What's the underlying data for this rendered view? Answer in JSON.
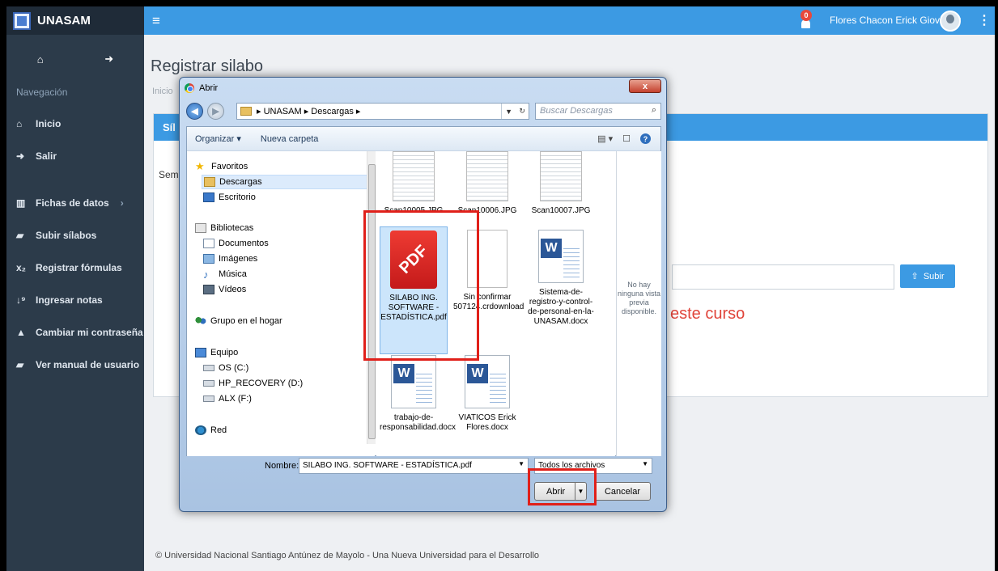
{
  "app": {
    "brand": "UNASAM",
    "user_name": "Flores Chacon Erick Giovanny",
    "notification_count": "0",
    "sidebar": {
      "nav_header": "Navegación",
      "items": [
        {
          "label": "Inicio",
          "icon": "home-icon"
        },
        {
          "label": "Salir",
          "icon": "sign-out-icon"
        },
        {
          "label": "Fichas de datos",
          "icon": "bar-chart-icon",
          "chevron": "›"
        },
        {
          "label": "Subir sílabos",
          "icon": "book-icon"
        },
        {
          "label": "Registrar fórmulas",
          "icon": "subscript-icon"
        },
        {
          "label": "Ingresar notas",
          "icon": "sort-numeric-icon"
        },
        {
          "label": "Cambiar mi contraseña",
          "icon": "lock-icon"
        },
        {
          "label": "Ver manual de usuario",
          "icon": "book-icon"
        }
      ]
    },
    "page_title": "Registrar silabo",
    "breadcrumb": "Inicio",
    "panel_heading": "Síl",
    "semester_label": "Sem",
    "upload_button": "Subir",
    "no_syllabus_text": "este curso",
    "footer": "© Universidad Nacional Santiago Antúnez de Mayolo - Una Nueva Universidad para el Desarrollo",
    "colors": {
      "topbar": "#3c9ae3",
      "sidebar": "#2c3b4a",
      "alert": "#e0443a"
    }
  },
  "dialog": {
    "title": "Abrir",
    "close": "x",
    "address": [
      "UNASAM",
      "Descargas"
    ],
    "search_placeholder": "Buscar Descargas",
    "toolbar": {
      "organize": "Organizar ▾",
      "new_folder": "Nueva carpeta"
    },
    "nav_pane": {
      "favorites": "Favoritos",
      "downloads": "Descargas",
      "desktop": "Escritorio",
      "libraries": "Bibliotecas",
      "documents": "Documentos",
      "images": "Imágenes",
      "music": "Música",
      "videos": "Vídeos",
      "homegroup": "Grupo en el hogar",
      "computer": "Equipo",
      "drive_c": "OS (C:)",
      "drive_d": "HP_RECOVERY (D:)",
      "drive_f": "ALX (F:)",
      "network": "Red"
    },
    "files": [
      {
        "name": "Scan10005.JPG",
        "type": "scan"
      },
      {
        "name": "Scan10006.JPG",
        "type": "scan"
      },
      {
        "name": "Scan10007.JPG",
        "type": "scan"
      },
      {
        "name": "SILABO ING. SOFTWARE - ESTADÍSTICA.pdf",
        "type": "pdf",
        "selected": true
      },
      {
        "name": "Sin confirmar 507124.crdownload",
        "type": "blank"
      },
      {
        "name": "Sistema-de-registro-y-control-de-personal-en-la-UNASAM.docx",
        "type": "word"
      },
      {
        "name": "trabajo-de-responsabilidad.docx",
        "type": "word"
      },
      {
        "name": "VIATICOS Erick Flores.docx",
        "type": "word"
      }
    ],
    "preview_text": "No hay ninguna vista previa disponible.",
    "filename_label": "Nombre:",
    "filename_value": "SILABO ING. SOFTWARE - ESTADÍSTICA.pdf",
    "filter_value": "Todos los archivos",
    "open_button": "Abrir",
    "cancel_button": "Cancelar"
  }
}
